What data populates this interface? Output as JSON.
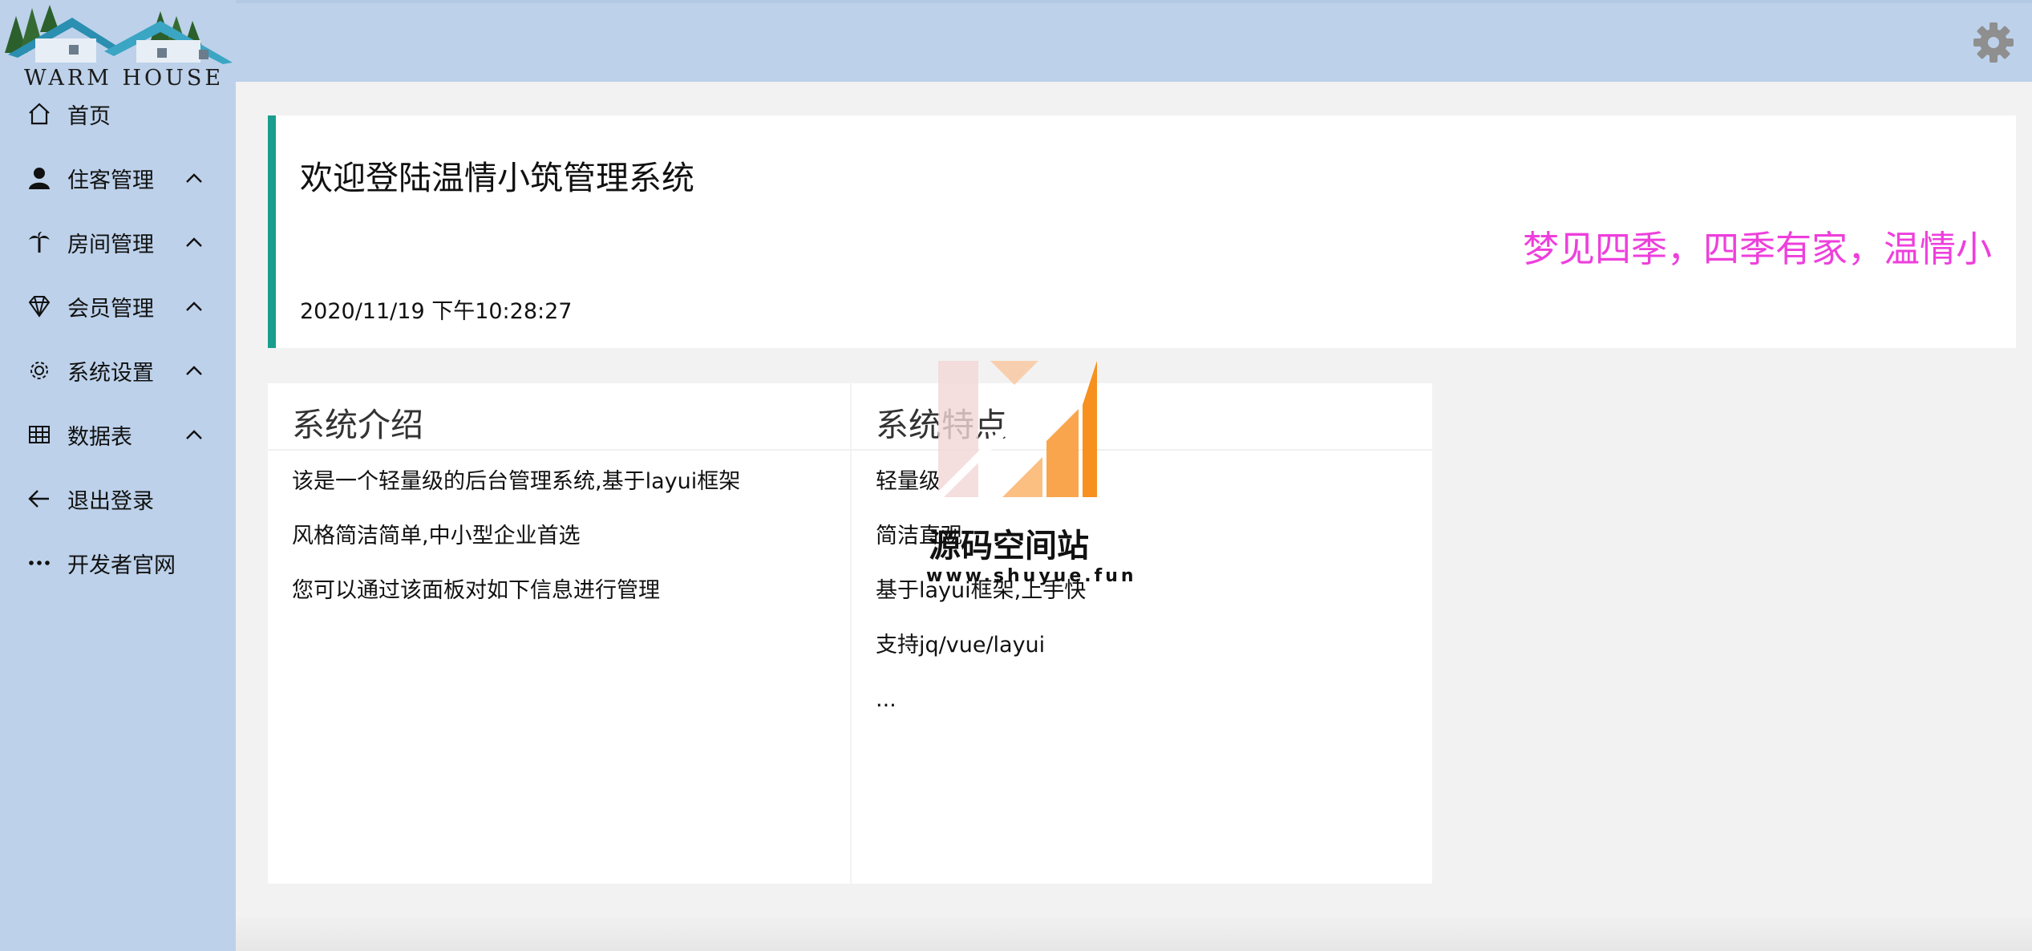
{
  "logo": {
    "text": "WARM HOUSE"
  },
  "sidebar": {
    "items": [
      {
        "label": "首页",
        "icon": "home-icon"
      },
      {
        "label": "住客管理",
        "icon": "user-icon"
      },
      {
        "label": "房间管理",
        "icon": "palm-tree-icon"
      },
      {
        "label": "会员管理",
        "icon": "diamond-icon"
      },
      {
        "label": "系统设置",
        "icon": "gear-icon"
      },
      {
        "label": "数据表",
        "icon": "table-icon"
      },
      {
        "label": "退出登录",
        "icon": "back-arrow-icon"
      },
      {
        "label": "开发者官网",
        "icon": "more-dots-icon"
      }
    ]
  },
  "header": {
    "settings_icon": "gear-icon"
  },
  "welcome": {
    "title": "欢迎登陆温情小筑管理系统",
    "marquee": "梦见四季，四季有家，温情小",
    "datetime": "2020/11/19 下午10:28:27"
  },
  "intro_panel": {
    "title": "系统介绍",
    "lines": [
      "该是一个轻量级的后台管理系统,基于layui框架",
      "风格简洁简单,中小型企业首选",
      "您可以通过该面板对如下信息进行管理"
    ]
  },
  "features_panel": {
    "title": "系统特点",
    "lines": [
      "轻量级",
      "简洁直观",
      "基于layui框架,上手快",
      "支持jq/vue/layui",
      "..."
    ]
  },
  "watermark": {
    "title": "源码空间站",
    "url": "www.shuyue.fun"
  },
  "colors": {
    "sidebar_bg": "#bdd1ea",
    "accent": "#1a9d8e",
    "marquee": "#ee3fdc"
  }
}
